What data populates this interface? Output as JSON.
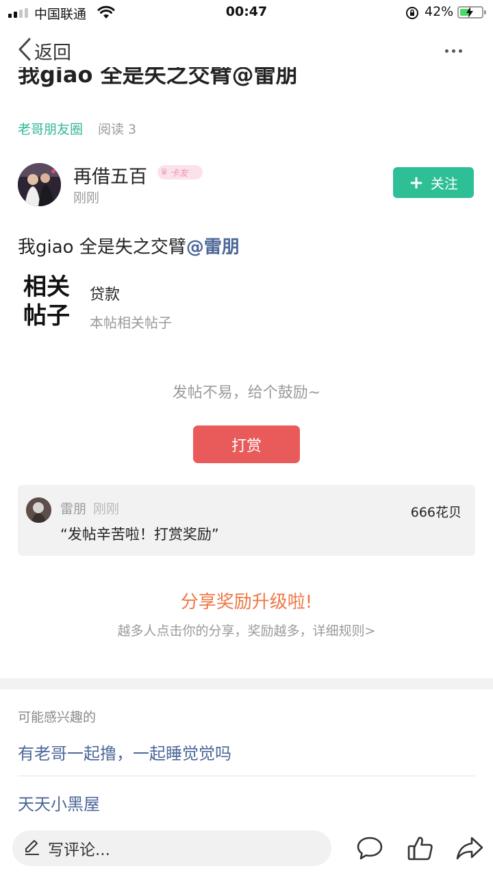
{
  "status_bar": {
    "carrier": "中国联通",
    "time": "00:47",
    "battery_percent": "42%",
    "battery_level": 0.42
  },
  "nav": {
    "back_label": "返回"
  },
  "post": {
    "title": "我giao 全是失之交臂@雷朋",
    "circle": "老哥朋友圈",
    "read_count": "阅读 3",
    "author": {
      "name": "再借五百",
      "badge": "卡友",
      "time": "刚刚"
    },
    "follow_label": "关注",
    "body_text": "我giao 全是失之交臂",
    "mention": "@雷朋"
  },
  "related": {
    "label_line1": "相关",
    "label_line2": "帖子",
    "item_title": "贷款",
    "item_sub": "本帖相关帖子"
  },
  "reward": {
    "encourage_text": "发帖不易，给个鼓励~",
    "button_label": "打赏",
    "record": {
      "name": "雷朋",
      "time": "刚刚",
      "amount": "666花贝",
      "message": "“发帖辛苦啦！打赏奖励”"
    }
  },
  "share": {
    "title": "分享奖励升级啦!",
    "subtitle": "越多人点击你的分享，奖励越多，详细规则>"
  },
  "recommend": {
    "title": "可能感兴趣的",
    "items": [
      "有老哥一起撸，一起睡觉觉吗",
      "天天小黑屋"
    ]
  },
  "bottom_bar": {
    "comment_placeholder": "写评论..."
  },
  "colors": {
    "green_accent": "#2fbf96",
    "circle_green": "#34b796",
    "reward_red": "#e95a5a",
    "share_orange": "#ef7744",
    "link_blue": "#4d6799"
  },
  "icons": {
    "signal": "signal-icon",
    "wifi": "wifi-icon",
    "orientation_lock": "orientation-lock-icon",
    "battery": "battery-icon",
    "back": "chevron-left-icon",
    "more": "more-dots-icon",
    "plus": "plus-icon",
    "pencil": "pencil-icon",
    "comment": "comment-bubble-icon",
    "like": "thumbs-up-icon",
    "share": "share-arrow-icon"
  }
}
